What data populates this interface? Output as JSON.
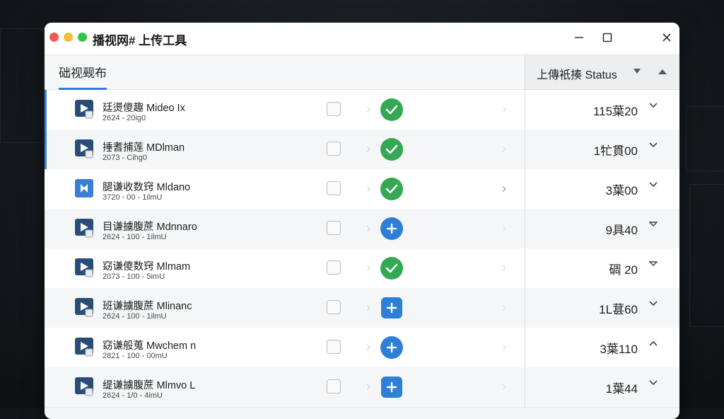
{
  "window": {
    "title": "播视网# 上传工具",
    "controls": [
      "minimize",
      "maximize",
      "close"
    ],
    "traffic_lights": {
      "red": "#ee5b53",
      "yellow": "#f4bd3c",
      "green": "#33c548"
    }
  },
  "header": {
    "tab_label": "础视觋布",
    "status_label": "上傳衹揍 Status"
  },
  "colors": {
    "accent": "#2f7fd6",
    "success": "#34a853"
  },
  "rows": [
    {
      "title": "廷燙傻趣 Mideo Ix",
      "subtitle": "2624 - 20ig0",
      "action": "check",
      "time": "115葉20",
      "chevron": "down",
      "selected": true
    },
    {
      "title": "捶耆捕莲 MDlman",
      "subtitle": "2073 - Cihg0",
      "action": "check",
      "time": "1牤貫00",
      "chevron": "down",
      "selected": true
    },
    {
      "title": "腿谦收数窍 Mldano",
      "subtitle": "3720 - 00 - 1ilmU",
      "action": "check",
      "time": "3葉00",
      "chevron": "down",
      "selected": false
    },
    {
      "title": "目谦擄腹蔗 Mdnnaro",
      "subtitle": "2624 - 100 - 1ilmU",
      "action": "plus-circle",
      "time": "9具40",
      "chevron": "down-small",
      "selected": false
    },
    {
      "title": "窈谦傻数窍 Mlmam",
      "subtitle": "2073 - 100 - 5imU",
      "action": "check",
      "time": "碉 20",
      "chevron": "down-small",
      "selected": false
    },
    {
      "title": "班谦擄腹蔗 Mlinanc",
      "subtitle": "2624 - 100 - 1ilmU",
      "action": "plus-square",
      "time": "1L葚60",
      "chevron": "down",
      "selected": false
    },
    {
      "title": "窈谦般蒐 Mwchem n",
      "subtitle": "2821 - 100 - 00mU",
      "action": "plus-circle",
      "time": "3葉110",
      "chevron": "up",
      "selected": false
    },
    {
      "title": "缇谦擄腹蔗 Mlmvo L",
      "subtitle": "2624 - 1/0 - 4imU",
      "action": "plus-square",
      "time": "1葉44",
      "chevron": "down",
      "selected": false
    }
  ]
}
